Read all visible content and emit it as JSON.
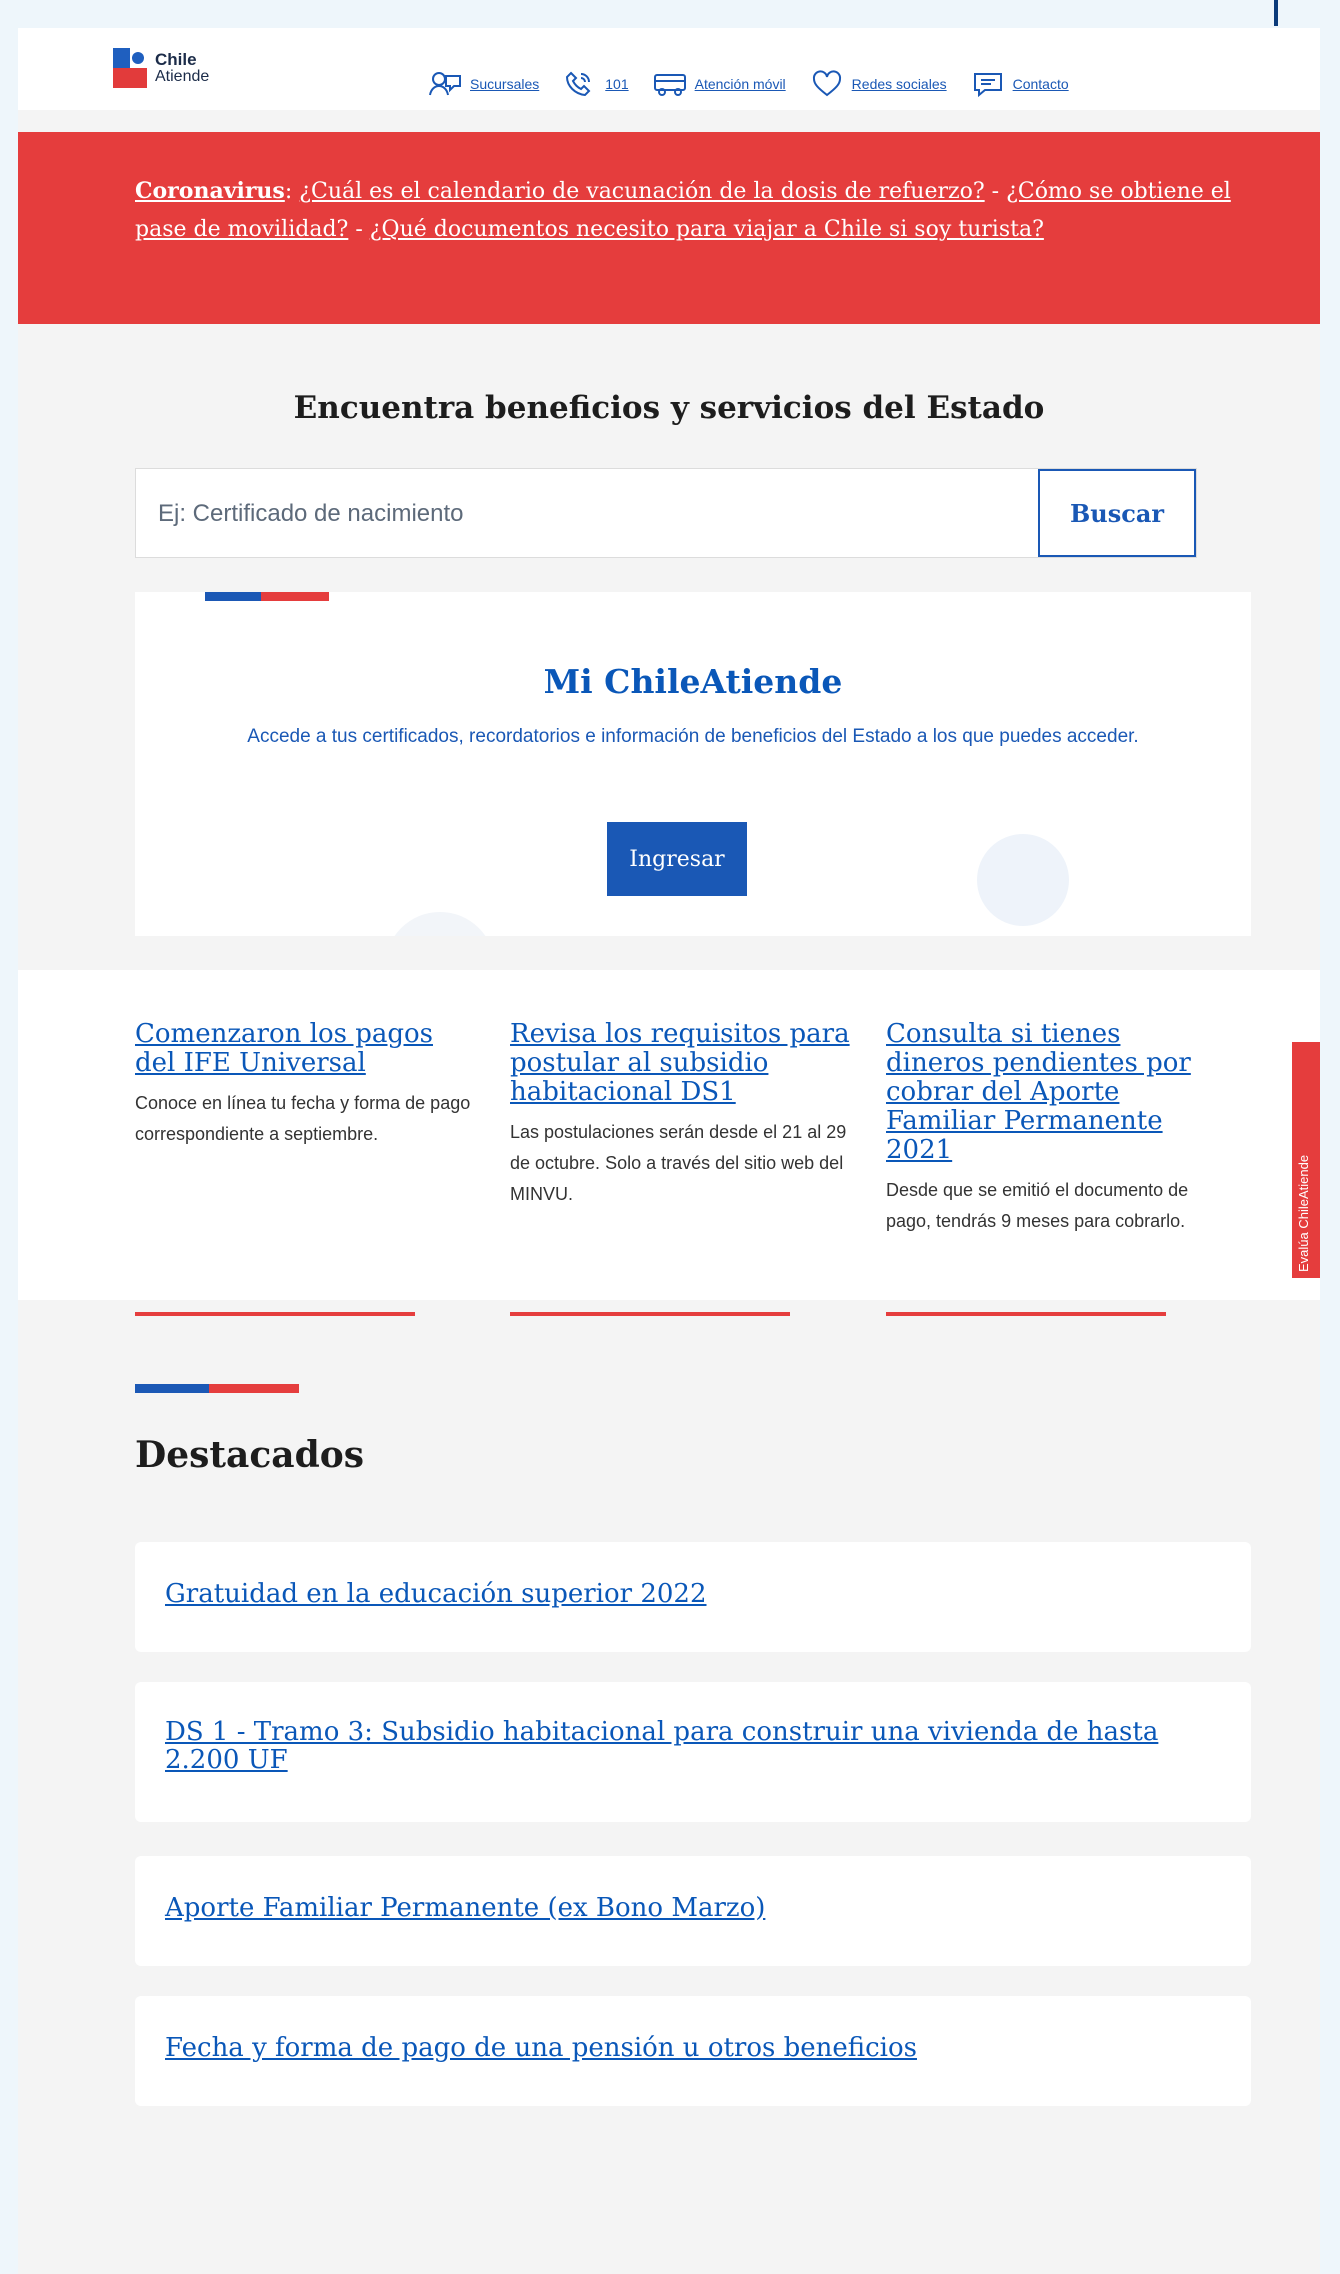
{
  "header": {
    "logo_line1": "Chile",
    "logo_line2": "Atiende",
    "nav": [
      {
        "label": "Sucursales",
        "icon": "people-icon"
      },
      {
        "label": "101",
        "icon": "phone-icon"
      },
      {
        "label": "Atención móvil",
        "icon": "bus-icon"
      },
      {
        "label": "Redes sociales",
        "icon": "heart-icon"
      },
      {
        "label": "Contacto",
        "icon": "chat-icon"
      }
    ]
  },
  "alert": {
    "lead": "Coronavirus",
    "sep0": ": ",
    "links": [
      "¿Cuál es el calendario de vacunación de la dosis de refuerzo?",
      "¿Cómo se obtiene el pase de movilidad?",
      "¿Qué documentos necesito para viajar a Chile si soy turista?"
    ],
    "separator": " - "
  },
  "search": {
    "title": "Encuentra beneficios y servicios del Estado",
    "placeholder": "Ej: Certificado de nacimiento",
    "button": "Buscar"
  },
  "mi_chileatiende": {
    "title": "Mi ChileAtiende",
    "description": "Accede a tus certificados, recordatorios e información de beneficios del Estado a los que puedes acceder.",
    "button": "Ingresar"
  },
  "news": [
    {
      "title": "Comenzaron los pagos del IFE Universal",
      "description": "Conoce en línea tu fecha y forma de pago correspondiente a septiembre."
    },
    {
      "title": "Revisa los requisitos para postular al subsidio habitacional DS1",
      "description": "Las postulaciones serán desde el 21 al 29 de octubre. Solo a través del sitio web del MINVU."
    },
    {
      "title": "Consulta si tienes dineros pendientes por cobrar del Aporte Familiar Permanente 2021",
      "description": "Desde que se emitió el documento de pago, tendrás 9 meses para cobrarlo."
    }
  ],
  "feedback_tab": "Evalúa ChileAtiende",
  "destacados": {
    "title": "Destacados",
    "items": [
      "Gratuidad en la educación superior 2022",
      "DS 1 - Tramo 3: Subsidio habitacional para construir una vivienda de hasta 2.200 UF",
      "Aporte Familiar Permanente (ex Bono Marzo)",
      "Fecha y forma de pago de una pensión u otros beneficios"
    ]
  },
  "colors": {
    "brand_blue": "#1a58b5",
    "brand_red": "#e53d3d",
    "background": "#f4f4f4"
  }
}
